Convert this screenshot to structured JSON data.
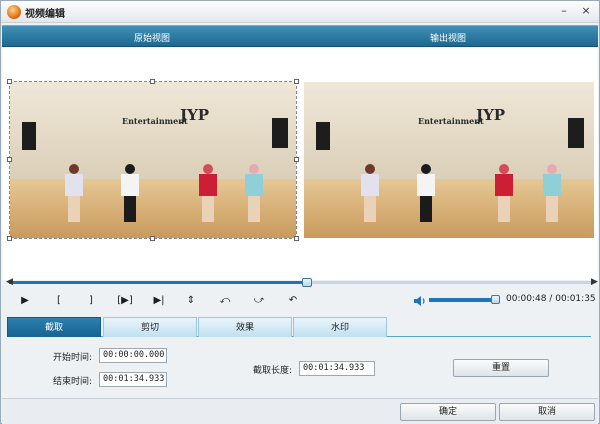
{
  "window": {
    "title": "视频编辑",
    "minimize_glyph": "–",
    "close_glyph": "×"
  },
  "view_headers": {
    "original": "原始视图",
    "output": "输出视图"
  },
  "video": {
    "logo_text": "JYP",
    "logo_sub": "Entertainment"
  },
  "playback": {
    "progress_fraction": 0.51,
    "controls": [
      {
        "name": "play-button",
        "glyph": "▶"
      },
      {
        "name": "set-start-button",
        "glyph": "["
      },
      {
        "name": "set-end-button",
        "glyph": "]"
      },
      {
        "name": "play-selection-button",
        "glyph": "[▶]"
      },
      {
        "name": "next-frame-button",
        "glyph": "▶|"
      },
      {
        "name": "flip-vertical-button",
        "glyph": "⇕"
      },
      {
        "name": "rotate-left-button",
        "glyph": "⤺"
      },
      {
        "name": "rotate-right-button",
        "glyph": "⤻"
      },
      {
        "name": "undo-button",
        "glyph": "↶"
      }
    ],
    "volume_fraction": 0.95,
    "time_current": "00:00:48",
    "time_separator": "/",
    "time_total": "00:01:35"
  },
  "tabs": {
    "crop": "截取",
    "cut": "剪切",
    "effect": "效果",
    "watermark": "水印"
  },
  "trim": {
    "start_label": "开始时间:",
    "start_value": "00:00:00.000",
    "end_label": "结束时间:",
    "end_value": "00:01:34.933",
    "length_label": "截取长度:",
    "length_value": "00:01:34.933",
    "reset_label": "重置"
  },
  "footer": {
    "ok_label": "确定",
    "cancel_label": "取消"
  },
  "colors": {
    "accent": "#1e6892",
    "tab_active": "#176391"
  }
}
